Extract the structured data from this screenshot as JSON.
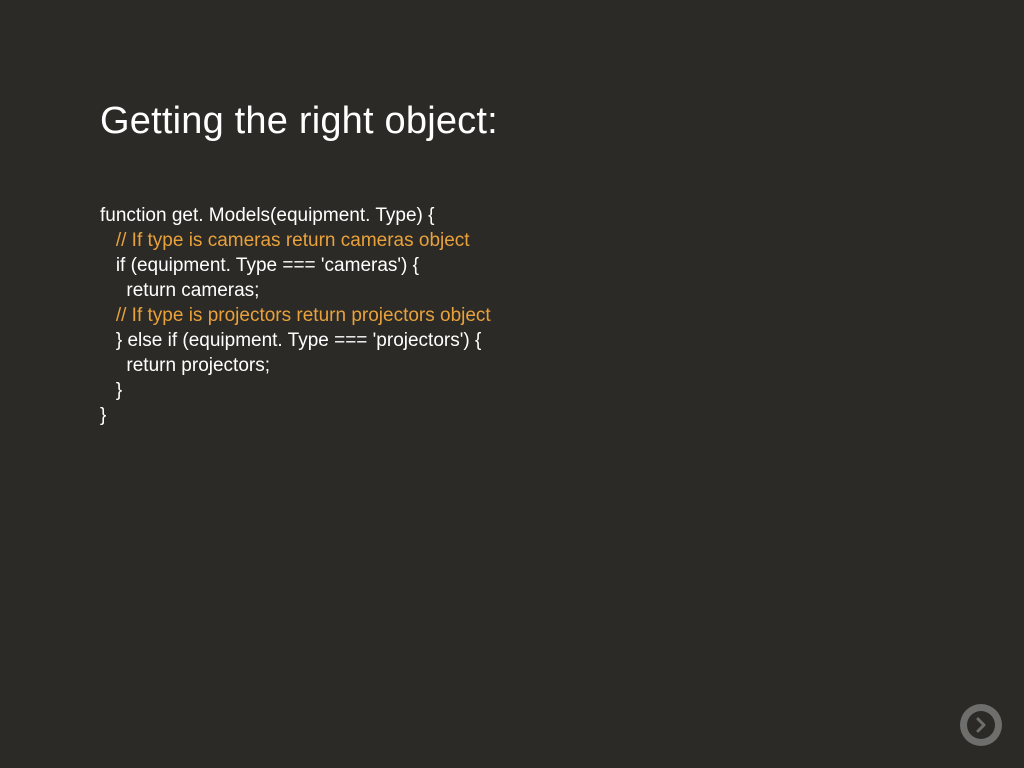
{
  "slide": {
    "title": "Getting the right object:",
    "code": {
      "l1": "function get. Models(equipment. Type) {",
      "l2": "   // If type is cameras return cameras object",
      "l3": "   if (equipment. Type === 'cameras') {",
      "l4": "     return cameras;",
      "l5": "   // If type is projectors return projectors object",
      "l6": "   } else if (equipment. Type === 'projectors') {",
      "l7": "     return projectors;",
      "l8": "   }",
      "l9": "}"
    }
  },
  "controls": {
    "next_label": "next"
  }
}
